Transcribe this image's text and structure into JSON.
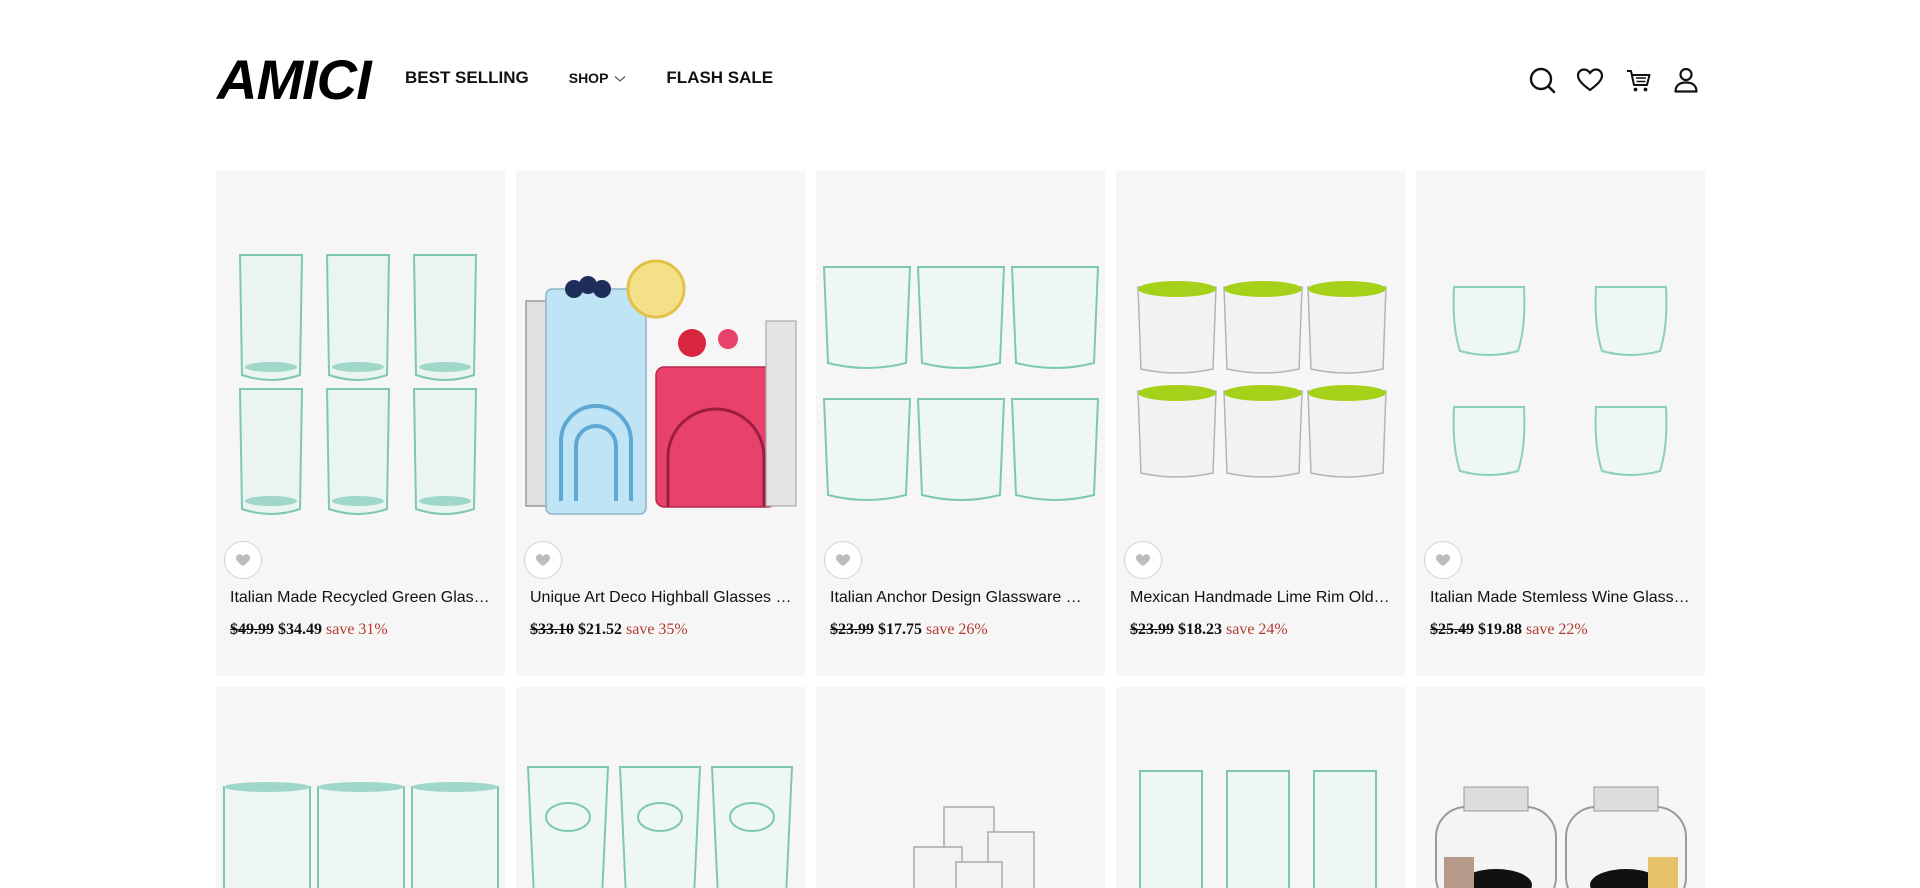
{
  "brand": {
    "logo": "AMICI"
  },
  "nav": {
    "best_selling": "BEST SELLING",
    "shop": "SHOP",
    "flash_sale": "FLASH SALE"
  },
  "header_icons": [
    "search-icon",
    "heart-icon",
    "cart-icon",
    "account-icon"
  ],
  "colors": {
    "save_text": "#b03a2e",
    "card_bg": "#f6f6f6",
    "green_glass": "#7fc7b5",
    "lime_rim": "#9acd1a"
  },
  "products": [
    {
      "title": "Italian Made Recycled Green Glass…",
      "old_price": "$49.99",
      "price": "$34.49",
      "save": "save 31%"
    },
    {
      "title": "Unique Art Deco Highball Glasses S…",
      "old_price": "$33.10",
      "price": "$21.52",
      "save": "save 35%"
    },
    {
      "title": "Italian Anchor Design Glassware Set…",
      "old_price": "$23.99",
      "price": "$17.75",
      "save": "save 26%"
    },
    {
      "title": "Mexican Handmade Lime Rim Old…",
      "old_price": "$23.99",
      "price": "$18.23",
      "save": "save 24%"
    },
    {
      "title": "Italian Made Stemless Wine Glasses…",
      "old_price": "$25.49",
      "price": "$19.88",
      "save": "save 22%"
    }
  ]
}
